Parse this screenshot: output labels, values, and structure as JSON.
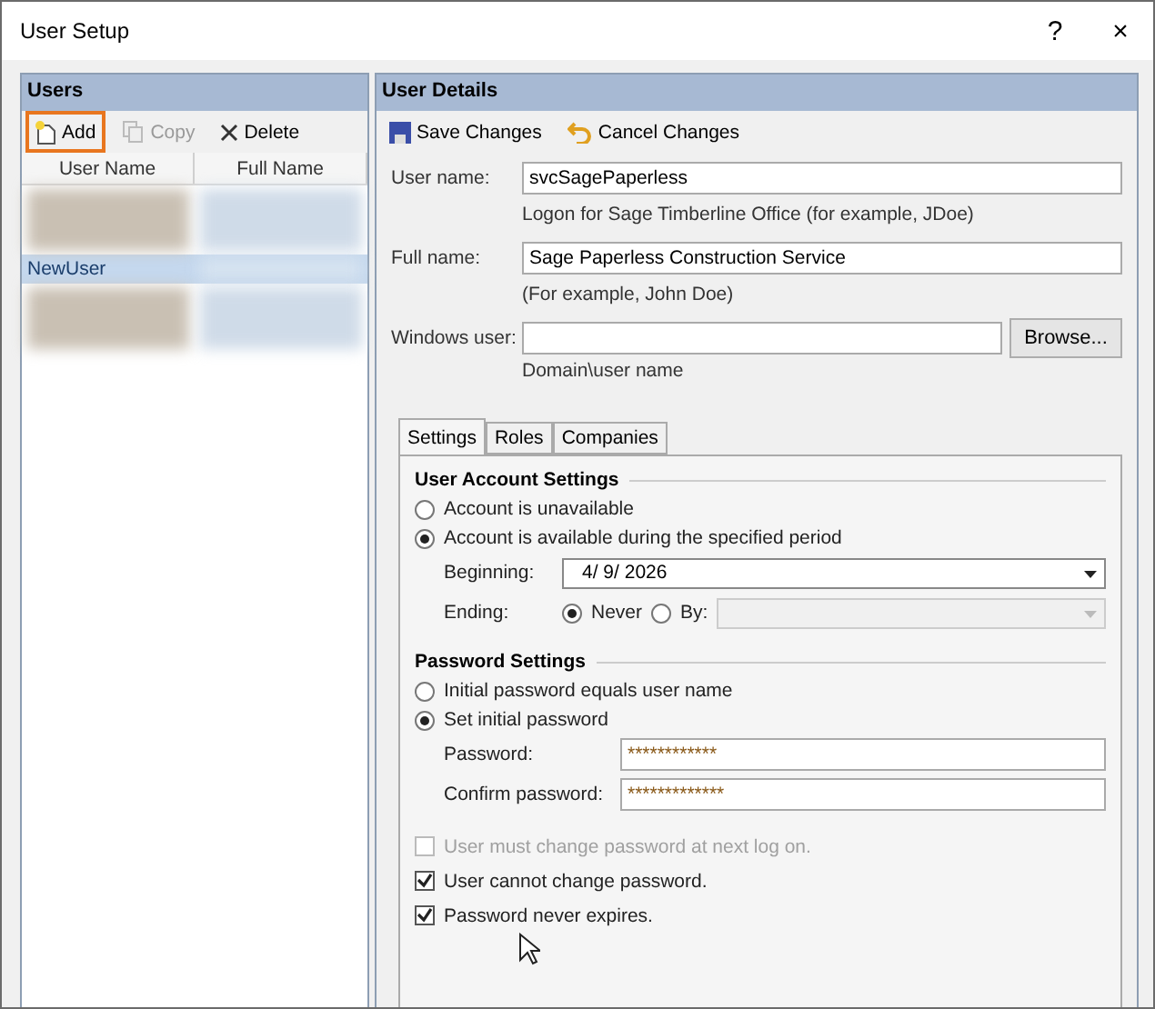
{
  "window": {
    "title": "User Setup",
    "help": "?",
    "close": "×"
  },
  "users_panel": {
    "title": "Users",
    "toolbar": [
      {
        "kind": "add",
        "label": "Add",
        "disabled": false,
        "highlighted": true
      },
      {
        "kind": "copy",
        "label": "Copy",
        "disabled": true,
        "highlighted": false
      },
      {
        "kind": "delete",
        "label": "Delete",
        "disabled": false,
        "highlighted": false
      }
    ],
    "columns": [
      "User Name",
      "Full Name"
    ],
    "rows": [
      {
        "kind": "blurred",
        "selected": false
      },
      {
        "kind": "user",
        "user_name": "NewUser",
        "selected": true
      },
      {
        "kind": "blurred",
        "selected": false
      }
    ]
  },
  "details_panel": {
    "title": "User Details",
    "toolbar": [
      {
        "kind": "save",
        "label": "Save Changes"
      },
      {
        "kind": "cancel",
        "label": "Cancel Changes"
      }
    ],
    "fields": [
      {
        "label": "User name:",
        "value": "svcSagePaperless",
        "hint": "Logon for Sage Timberline Office (for example, JDoe)"
      },
      {
        "label": "Full name:",
        "value": "Sage Paperless Construction Service",
        "hint": "(For example, John Doe)"
      },
      {
        "label": "Windows user:",
        "hint": "Domain\\user name",
        "button": "Browse..."
      }
    ],
    "tabs": [
      {
        "label": "Settings",
        "selected": true
      },
      {
        "label": "Roles",
        "selected": false
      },
      {
        "label": "Companies",
        "selected": false
      }
    ],
    "account": {
      "title": "User Account Settings",
      "options": [
        {
          "label": "Account is unavailable",
          "selected": false
        },
        {
          "label": "Account is available during the specified period",
          "selected": true
        }
      ],
      "beginning_label": "Beginning:",
      "beginning": "4/  9/ 2026",
      "ending_label": "Ending:",
      "ending_options": [
        {
          "label": "Never",
          "selected": true
        },
        {
          "label": "By:",
          "selected": false
        }
      ]
    },
    "password": {
      "title": "Password Settings",
      "options": [
        {
          "label": "Initial password equals user name",
          "selected": false
        },
        {
          "label": "Set initial password",
          "selected": true
        }
      ],
      "fields": [
        {
          "label": "Password:",
          "value": "************"
        },
        {
          "label": "Confirm password:",
          "value": "*************"
        }
      ],
      "checks": [
        {
          "label": "User must change password at next log on.",
          "checked": false,
          "disabled": true
        },
        {
          "label": "User cannot change password.",
          "checked": true,
          "disabled": false
        },
        {
          "label": "Password never expires.",
          "checked": true,
          "disabled": false
        }
      ]
    }
  }
}
